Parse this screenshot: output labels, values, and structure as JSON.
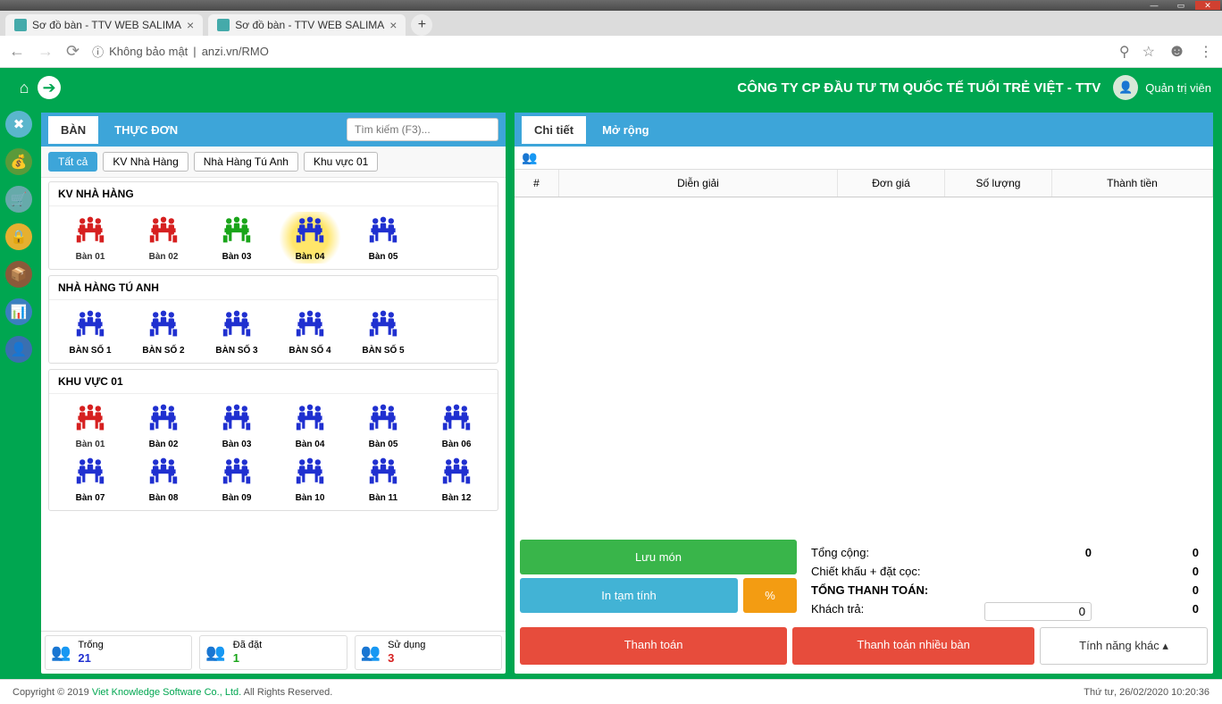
{
  "window": {
    "tabs": [
      "Sơ đồ bàn - TTV WEB SALIMA",
      "Sơ đồ bàn - TTV WEB SALIMA"
    ]
  },
  "addr": {
    "insecure": "Không bảo mật",
    "url": "anzi.vn/RMO"
  },
  "header": {
    "company": "CÔNG TY CP ĐẦU TƯ TM QUỐC TẾ TUỔI TRẺ VIỆT - TTV",
    "user": "Quản trị viên"
  },
  "leftTabs": {
    "ban": "BÀN",
    "thucdon": "THỰC ĐƠN"
  },
  "search": {
    "placeholder": "Tìm kiếm (F3)..."
  },
  "filters": [
    "Tất cả",
    "KV Nhà Hàng",
    "Nhà Hàng Tú Anh",
    "Khu vực 01"
  ],
  "areas": [
    {
      "name": "KV NHÀ HÀNG",
      "tables": [
        {
          "label": "Bàn 01",
          "cls": "c-red"
        },
        {
          "label": "Bàn 02",
          "cls": "c-red"
        },
        {
          "label": "Bàn 03",
          "cls": "c-green"
        },
        {
          "label": "Bàn 04",
          "cls": "c-blue c-sel"
        },
        {
          "label": "Bàn 05",
          "cls": "c-blue"
        }
      ]
    },
    {
      "name": "NHÀ HÀNG TÚ ANH",
      "tables": [
        {
          "label": "BÀN SỐ 1",
          "cls": "c-blue"
        },
        {
          "label": "BÀN SỐ 2",
          "cls": "c-blue"
        },
        {
          "label": "BÀN SỐ 3",
          "cls": "c-blue"
        },
        {
          "label": "BÀN SỐ 4",
          "cls": "c-blue"
        },
        {
          "label": "BÀN SỐ 5",
          "cls": "c-blue"
        }
      ]
    },
    {
      "name": "KHU VỰC 01",
      "tables": [
        {
          "label": "Bàn 01",
          "cls": "c-red"
        },
        {
          "label": "Bàn 02",
          "cls": "c-blue"
        },
        {
          "label": "Bàn 03",
          "cls": "c-blue"
        },
        {
          "label": "Bàn 04",
          "cls": "c-blue"
        },
        {
          "label": "Bàn 05",
          "cls": "c-blue"
        },
        {
          "label": "Bàn 06",
          "cls": "c-blue"
        },
        {
          "label": "Bàn 07",
          "cls": "c-blue"
        },
        {
          "label": "Bàn 08",
          "cls": "c-blue"
        },
        {
          "label": "Bàn 09",
          "cls": "c-blue"
        },
        {
          "label": "Bàn 10",
          "cls": "c-blue"
        },
        {
          "label": "Bàn 11",
          "cls": "c-blue"
        },
        {
          "label": "Bàn 12",
          "cls": "c-blue"
        }
      ]
    }
  ],
  "legend": {
    "trong": {
      "label": "Trống",
      "num": "21"
    },
    "dadat": {
      "label": "Đã đặt",
      "num": "1"
    },
    "sudung": {
      "label": "Sử dụng",
      "num": "3"
    }
  },
  "rightTabs": {
    "chitiet": "Chi tiết",
    "morong": "Mở rộng"
  },
  "orderCols": {
    "c1": "#",
    "c2": "Diễn giải",
    "c3": "Đơn giá",
    "c4": "Số lượng",
    "c5": "Thành tiền"
  },
  "totals": {
    "tongcong": {
      "label": "Tổng cộng:",
      "v1": "0",
      "v2": "0"
    },
    "chietkhau": {
      "label": "Chiết khấu + đặt cọc:",
      "v2": "0"
    },
    "tongtt": {
      "label": "TỔNG THANH TOÁN:",
      "v2": "0"
    },
    "khachtra": {
      "label": "Khách trả:",
      "input": "0",
      "v2": "0"
    }
  },
  "buttons": {
    "luumon": "Lưu món",
    "intam": "In tạm tính",
    "percent": "%",
    "thanhtoan": "Thanh toán",
    "ttnb": "Thanh toán nhiều bàn",
    "tnk": "Tính năng khác"
  },
  "footer": {
    "copy": "Copyright © 2019 ",
    "link": "Viet Knowledge Software Co., Ltd.",
    "rest": " All Rights Reserved.",
    "clock": "Thứ tư, 26/02/2020 10:20:36"
  }
}
